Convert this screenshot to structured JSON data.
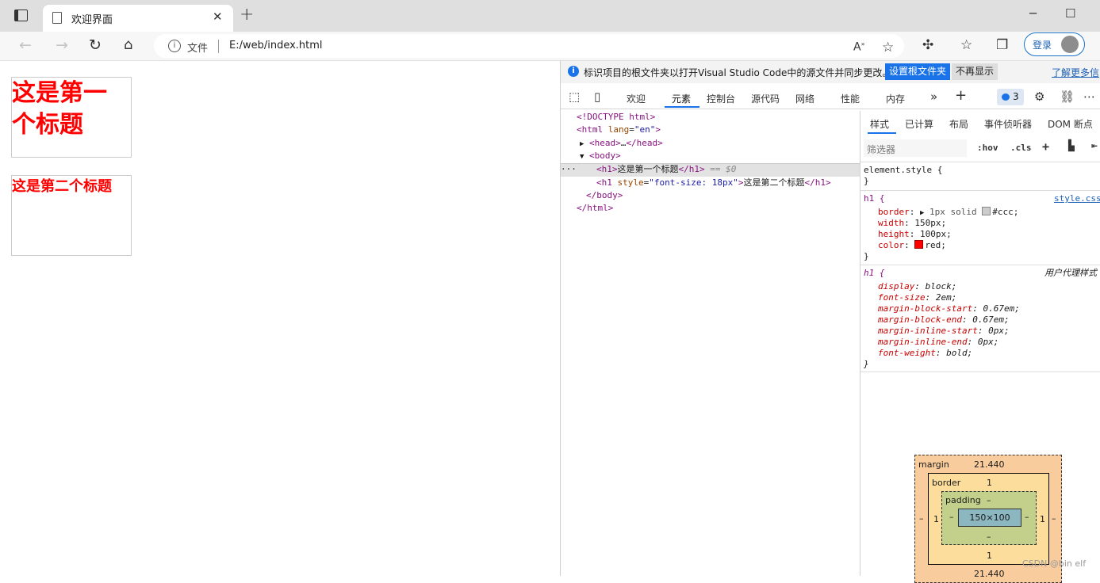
{
  "browser": {
    "tab_title": "欢迎界面",
    "tab_close": "✕",
    "new_tab": "+",
    "address_scheme": "文件",
    "address_url": "E:/web/index.html",
    "login_label": "登录",
    "window_minimize": "─",
    "window_maximize": "☐"
  },
  "page": {
    "heading1": [
      "这是第一",
      "个标题"
    ],
    "heading2": "这是第二个标题"
  },
  "devtools": {
    "infobar": {
      "message": "标识项目的根文件夹以打开Visual Studio Code中的源文件并同步更改。",
      "set_root_button": "设置根文件夹",
      "dont_show_button": "不再显示",
      "learn_more": "了解更多信"
    },
    "tabs": [
      "欢迎",
      "元素",
      "控制台",
      "源代码",
      "网络",
      "性能",
      "内存"
    ],
    "issues_count": "3",
    "elements": {
      "doctype": "<!DOCTYPE html>",
      "html_open_tag": "html",
      "html_lang_attr": "lang",
      "html_lang_value": "\"en\"",
      "head": "head",
      "head_ellipsis": "…",
      "body_open": "body",
      "h1_text": "这是第一个标题",
      "selected_marker": "== $0",
      "h1b_attr": "style",
      "h1b_attr_value": "\"font-size: 18px\"",
      "h1b_text": "这是第二个标题",
      "body_close": "/body",
      "html_close": "/html",
      "row_dots": "···"
    },
    "side_tabs": [
      "样式",
      "已计算",
      "布局",
      "事件侦听器",
      "DOM 断点"
    ],
    "filter_placeholder": "筛选器",
    "hov_label": ":hov",
    "cls_label": ".cls",
    "styles": {
      "element_style": "element.style {",
      "close_brace": "}",
      "rule1_selector": "h1 {",
      "rule1_source": "style.css",
      "rule1_props": [
        {
          "name": "border",
          "value": "1px solid #ccc;",
          "swatch": "#cccccc"
        },
        {
          "name": "width",
          "value": "150px;"
        },
        {
          "name": "height",
          "value": "100px;"
        },
        {
          "name": "color",
          "value": "red;",
          "swatch": "#ff0000"
        }
      ],
      "rule2_selector": "h1 {",
      "rule2_source": "用户代理样式",
      "rule2_props": [
        {
          "name": "display",
          "value": "block;"
        },
        {
          "name": "font-size",
          "value": "2em;"
        },
        {
          "name": "margin-block-start",
          "value": "0.67em;"
        },
        {
          "name": "margin-block-end",
          "value": "0.67em;"
        },
        {
          "name": "margin-inline-start",
          "value": "0px;"
        },
        {
          "name": "margin-inline-end",
          "value": "0px;"
        },
        {
          "name": "font-weight",
          "value": "bold;"
        }
      ]
    },
    "box_model": {
      "margin_label": "margin",
      "margin_top": "21.440",
      "margin_bottom": "21.440",
      "margin_left": "–",
      "margin_right": "–",
      "border_label": "border",
      "border_top": "1",
      "border_bottom": "1",
      "border_left": "1",
      "border_right": "1",
      "padding_label": "padding",
      "padding_top": "–",
      "padding_bottom": "–",
      "padding_left": "–",
      "padding_right": "–",
      "content": "150×100"
    }
  },
  "watermark": "CSDN @bin elf"
}
